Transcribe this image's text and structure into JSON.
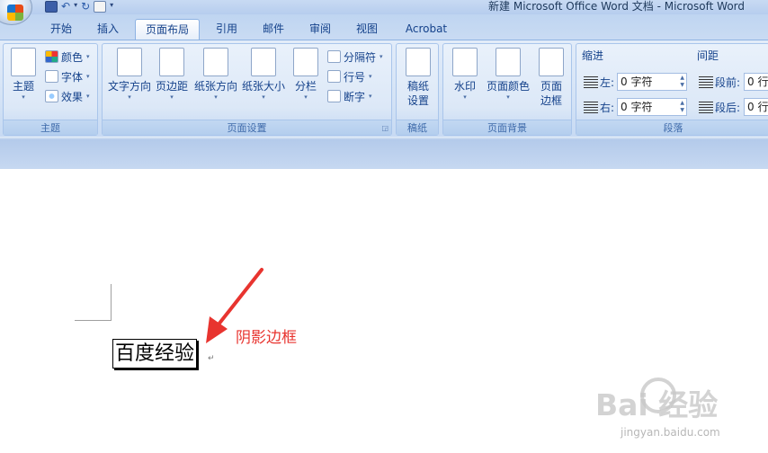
{
  "title": "新建 Microsoft Office Word 文档 - Microsoft Word",
  "tabs": [
    "开始",
    "插入",
    "页面布局",
    "引用",
    "邮件",
    "审阅",
    "视图",
    "Acrobat"
  ],
  "active_tab": "页面布局",
  "groups": {
    "theme": {
      "label": "主题",
      "theme_button": "主题",
      "colors": "颜色",
      "fonts": "字体",
      "effects": "效果"
    },
    "page_setup": {
      "label": "页面设置",
      "text_direction": "文字方向",
      "margins": "页边距",
      "orientation": "纸张方向",
      "size": "纸张大小",
      "columns": "分栏",
      "breaks": "分隔符",
      "line_numbers": "行号",
      "hyphenation": "断字"
    },
    "draft": {
      "label": "稿纸",
      "button_line1": "稿纸",
      "button_line2": "设置"
    },
    "background": {
      "label": "页面背景",
      "watermark": "水印",
      "page_color": "页面颜色",
      "page_border_line1": "页面",
      "page_border_line2": "边框"
    },
    "paragraph": {
      "label": "段落",
      "indent_title": "缩进",
      "spacing_title": "间距",
      "indent_left_label": "左:",
      "indent_left_value": "0 字符",
      "indent_right_label": "右:",
      "indent_right_value": "0 字符",
      "before_label": "段前:",
      "before_value": "0 行",
      "after_label": "段后:",
      "after_value": "0 行"
    }
  },
  "document": {
    "text": "百度经验",
    "paragraph_mark": "↵"
  },
  "annotation": "阴影边框",
  "watermark": {
    "brand": "Bai  经验",
    "url": "jingyan.baidu.com"
  },
  "colors": {
    "annotation": "#e8342f",
    "ribbon_text": "#15428b"
  }
}
